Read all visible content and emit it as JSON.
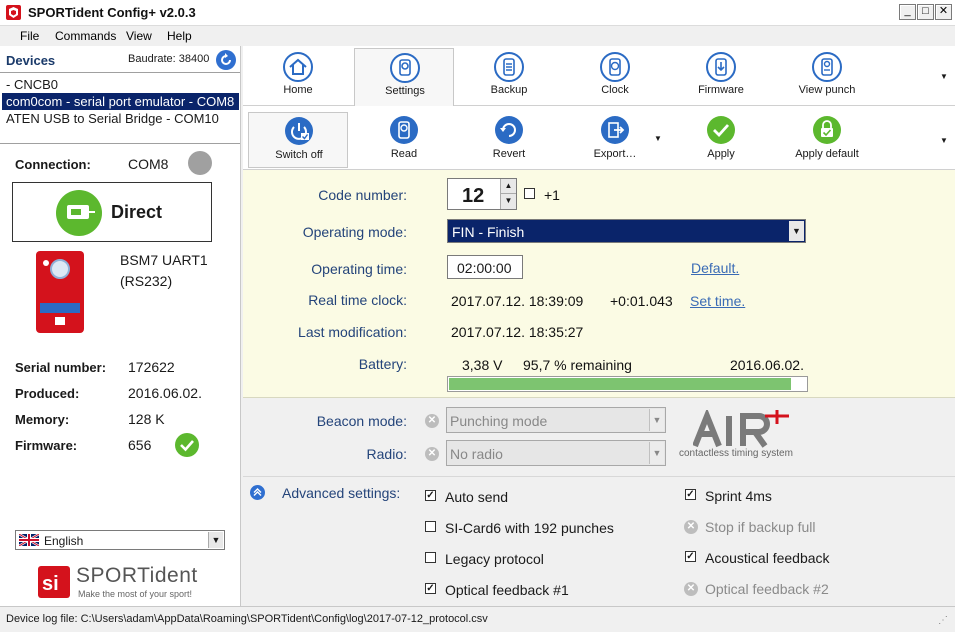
{
  "window": {
    "title": "SPORTident Config+ v2.0.3",
    "buttons": {
      "minimize": "_",
      "maximize": "□",
      "close": "✕"
    }
  },
  "menu": [
    "File",
    "Commands",
    "View",
    "Help"
  ],
  "devices": {
    "header": "Devices",
    "baudrate": "Baudrate: 38400",
    "items": [
      " - CNCB0",
      "com0com - serial port emulator - COM8",
      "ATEN USB to Serial Bridge - COM10"
    ],
    "selected_index": 1
  },
  "connection": {
    "label": "Connection:",
    "value": "COM8",
    "mode": "Direct"
  },
  "device_info": {
    "model_line1": "BSM7 UART1",
    "model_line2": "(RS232)",
    "serial_label": "Serial number:",
    "serial": "172622",
    "produced_label": "Produced:",
    "produced": "2016.06.02.",
    "memory_label": "Memory:",
    "memory": "128 K",
    "firmware_label": "Firmware:",
    "firmware": "656"
  },
  "language": {
    "value": "English"
  },
  "logo": {
    "name": "SPORTident",
    "tagline": "Make the most of your sport!"
  },
  "toolbar_top": [
    {
      "label": "Home",
      "icon": "home-icon"
    },
    {
      "label": "Settings",
      "icon": "settings-icon"
    },
    {
      "label": "Backup",
      "icon": "backup-icon"
    },
    {
      "label": "Clock",
      "icon": "clock-icon"
    },
    {
      "label": "Firmware",
      "icon": "firmware-icon"
    },
    {
      "label": "View punch",
      "icon": "view-punch-icon"
    }
  ],
  "toolbar_bottom": [
    {
      "label": "Switch off",
      "icon": "power-icon"
    },
    {
      "label": "Read",
      "icon": "read-icon"
    },
    {
      "label": "Revert",
      "icon": "revert-icon"
    },
    {
      "label": "Export…",
      "icon": "export-icon"
    },
    {
      "label": "Apply",
      "icon": "check-icon"
    },
    {
      "label": "Apply default",
      "icon": "lock-check-icon"
    }
  ],
  "form": {
    "code_label": "Code number:",
    "code_value": "12",
    "plus1_label": "+1",
    "mode_label": "Operating mode:",
    "mode_value": "FIN - Finish",
    "time_label": "Operating time:",
    "time_value": "02:00:00",
    "time_default_link": "Default.",
    "rtc_label": "Real time clock:",
    "rtc_value": "2017.07.12. 18:39:09",
    "rtc_offset": "+0:01.043",
    "rtc_link": "Set time.",
    "lastmod_label": "Last modification:",
    "lastmod_value": "2017.07.12. 18:35:27",
    "battery_label": "Battery:",
    "battery_voltage": "3,38 V",
    "battery_remaining": "95,7 % remaining",
    "battery_date": "2016.06.02.",
    "battery_level": 0.957
  },
  "lower": {
    "beacon_label": "Beacon mode:",
    "beacon_value": "Punching mode",
    "radio_label": "Radio:",
    "radio_value": "No radio",
    "air_logo": "AIR",
    "air_tagline": "contactless timing system",
    "advanced_label": "Advanced settings:",
    "options_left": [
      {
        "label": "Auto send",
        "state": "checked"
      },
      {
        "label": "SI-Card6 with 192 punches",
        "state": "unchecked"
      },
      {
        "label": "Legacy protocol",
        "state": "unchecked"
      },
      {
        "label": "Optical feedback #1",
        "state": "checked"
      }
    ],
    "options_right": [
      {
        "label": "Sprint 4ms",
        "state": "checked"
      },
      {
        "label": "Stop if backup full",
        "state": "disabled"
      },
      {
        "label": "Acoustical feedback",
        "state": "checked"
      },
      {
        "label": "Optical feedback #2",
        "state": "disabled"
      }
    ]
  },
  "statusbar": {
    "text": "Device log file: C:\\Users\\adam\\AppData\\Roaming\\SPORTident\\Config\\log\\2017-07-12_protocol.csv"
  },
  "colors": {
    "accent": "#2b6bc4",
    "selection": "#0a246a",
    "form_bg": "#fbfbe4",
    "battery_fill": "#7dc470",
    "ok_green": "#5cb82e",
    "brand_red": "#d4121c"
  }
}
